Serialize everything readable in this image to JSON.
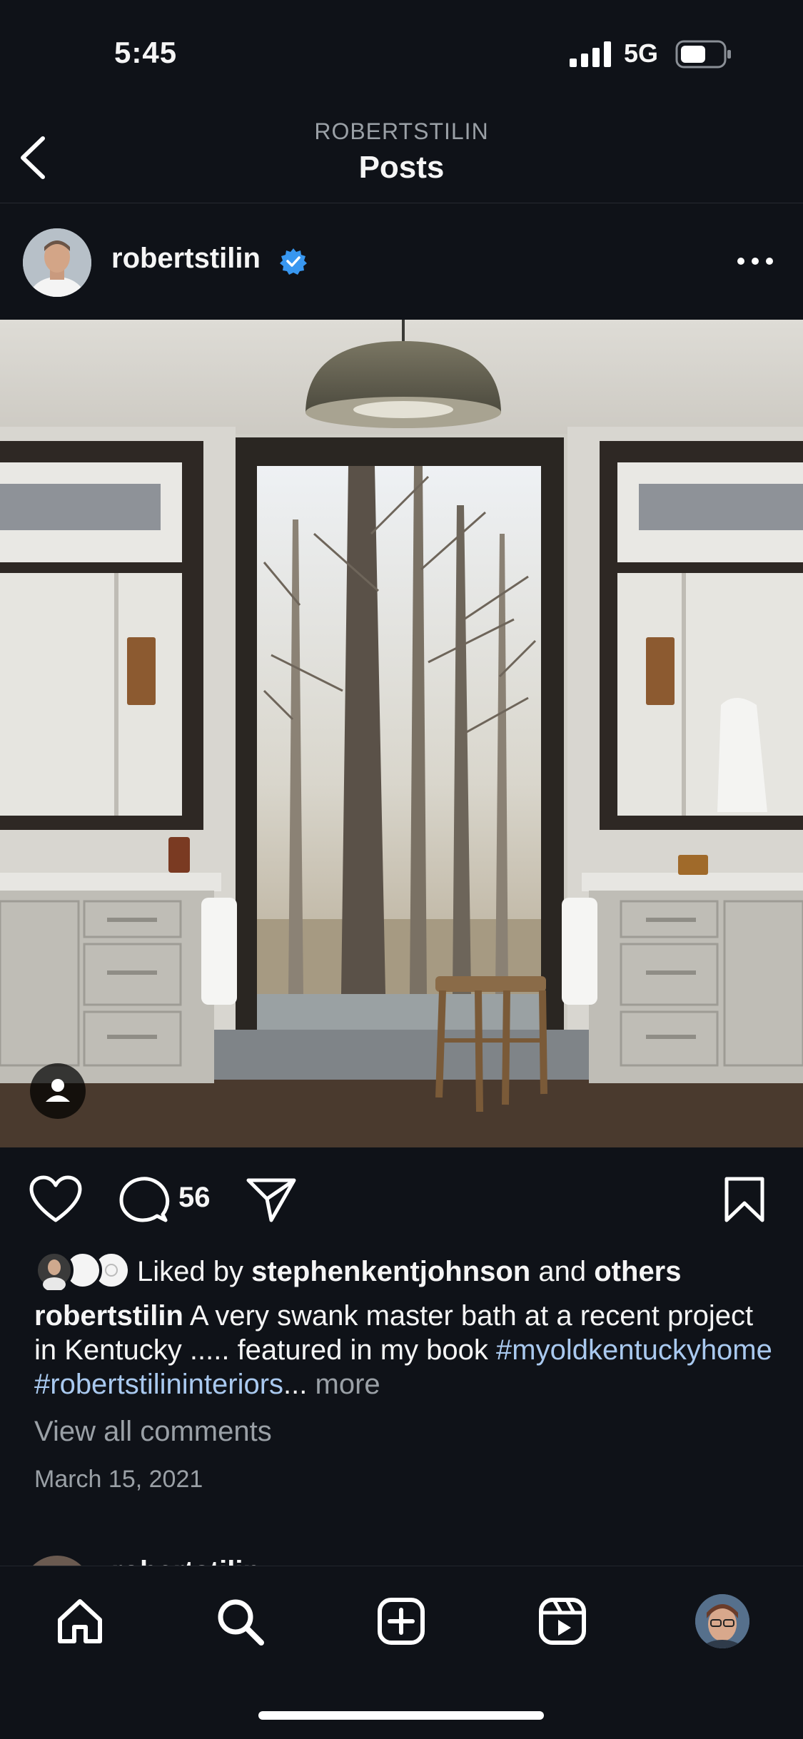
{
  "status_bar": {
    "time": "5:45",
    "network": "5G"
  },
  "header": {
    "subtitle": "ROBERTSTILIN",
    "title": "Posts"
  },
  "post": {
    "username": "robertstilin",
    "comment_count": "56",
    "liked_by_prefix": "Liked by",
    "liked_by_user": "stephenkentjohnson",
    "liked_by_and": "and",
    "liked_by_others": "others",
    "caption_user": "robertstilin",
    "caption_text": "A very swank master bath at a recent project in Kentucky ..... featured in my book",
    "hashtags": "#myoldkentuckyhome #robertstilininteriors",
    "ellipsis": "...",
    "more": "more",
    "view_comments": "View all comments",
    "date": "March 15, 2021"
  },
  "next_post": {
    "username": "robertstilin"
  },
  "colors": {
    "background": "#0f1218",
    "hashtag": "#a9c9ef",
    "verified": "#3897f0",
    "muted": "#9aa0a6"
  },
  "icons": [
    "back-icon",
    "verified-icon",
    "more-icon",
    "heart-icon",
    "comment-icon",
    "share-icon",
    "bookmark-icon",
    "home-icon",
    "search-icon",
    "create-icon",
    "reels-icon",
    "profile-avatar"
  ]
}
